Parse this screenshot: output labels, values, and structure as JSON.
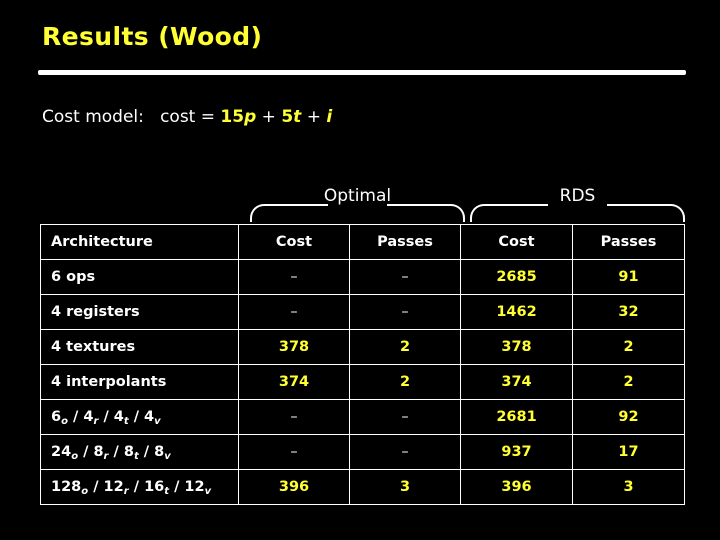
{
  "slide": {
    "title": "Results (Wood)",
    "cost_model": {
      "label": "Cost model:",
      "equation_lhs": "cost",
      "equals": "=",
      "term1_num": "15",
      "term1_var": "p",
      "plus1": "+",
      "term2_num": "5",
      "term2_var": "t",
      "plus2": "+",
      "term3_var": "i"
    },
    "groups": [
      {
        "label": "Optimal"
      },
      {
        "label": "RDS"
      }
    ],
    "table": {
      "headers": [
        "Architecture",
        "Cost",
        "Passes",
        "Cost",
        "Passes"
      ],
      "rows": [
        {
          "arch": "6 ops",
          "arch_parts": [
            {
              "t": "6 ops"
            }
          ],
          "optimal_cost": "–",
          "optimal_passes": "–",
          "rds_cost": "2685",
          "rds_passes": "91"
        },
        {
          "arch": "4 registers",
          "arch_parts": [
            {
              "t": "4 registers"
            }
          ],
          "optimal_cost": "–",
          "optimal_passes": "–",
          "rds_cost": "1462",
          "rds_passes": "32"
        },
        {
          "arch": "4 textures",
          "arch_parts": [
            {
              "t": "4 textures"
            }
          ],
          "optimal_cost": "378",
          "optimal_passes": "2",
          "rds_cost": "378",
          "rds_passes": "2"
        },
        {
          "arch": "4 interpolants",
          "arch_parts": [
            {
              "t": "4 interpolants"
            }
          ],
          "optimal_cost": "374",
          "optimal_passes": "2",
          "rds_cost": "374",
          "rds_passes": "2"
        },
        {
          "arch": "6o / 4r / 4t / 4v",
          "arch_parts": [
            {
              "t": "6"
            },
            {
              "sub": "o"
            },
            {
              "t": " / 4"
            },
            {
              "sub": "r"
            },
            {
              "t": " / 4"
            },
            {
              "sub": "t"
            },
            {
              "t": " / 4"
            },
            {
              "sub": "v"
            }
          ],
          "optimal_cost": "–",
          "optimal_passes": "–",
          "rds_cost": "2681",
          "rds_passes": "92"
        },
        {
          "arch": "24o / 8r / 8t / 8v",
          "arch_parts": [
            {
              "t": "24"
            },
            {
              "sub": "o"
            },
            {
              "t": " / 8"
            },
            {
              "sub": "r"
            },
            {
              "t": " / 8"
            },
            {
              "sub": "t"
            },
            {
              "t": " / 8"
            },
            {
              "sub": "v"
            }
          ],
          "optimal_cost": "–",
          "optimal_passes": "–",
          "rds_cost": "937",
          "rds_passes": "17"
        },
        {
          "arch": "128o / 12r / 16t / 12v",
          "arch_parts": [
            {
              "t": "128"
            },
            {
              "sub": "o"
            },
            {
              "t": " / 12"
            },
            {
              "sub": "r"
            },
            {
              "t": " / 16"
            },
            {
              "sub": "t"
            },
            {
              "t": " / 12"
            },
            {
              "sub": "v"
            }
          ],
          "optimal_cost": "396",
          "optimal_passes": "3",
          "rds_cost": "396",
          "rds_passes": "3"
        }
      ]
    },
    "colors": {
      "title": "#ffff33",
      "value": "#ffff33",
      "text": "#ffffff",
      "background": "#000000"
    }
  }
}
